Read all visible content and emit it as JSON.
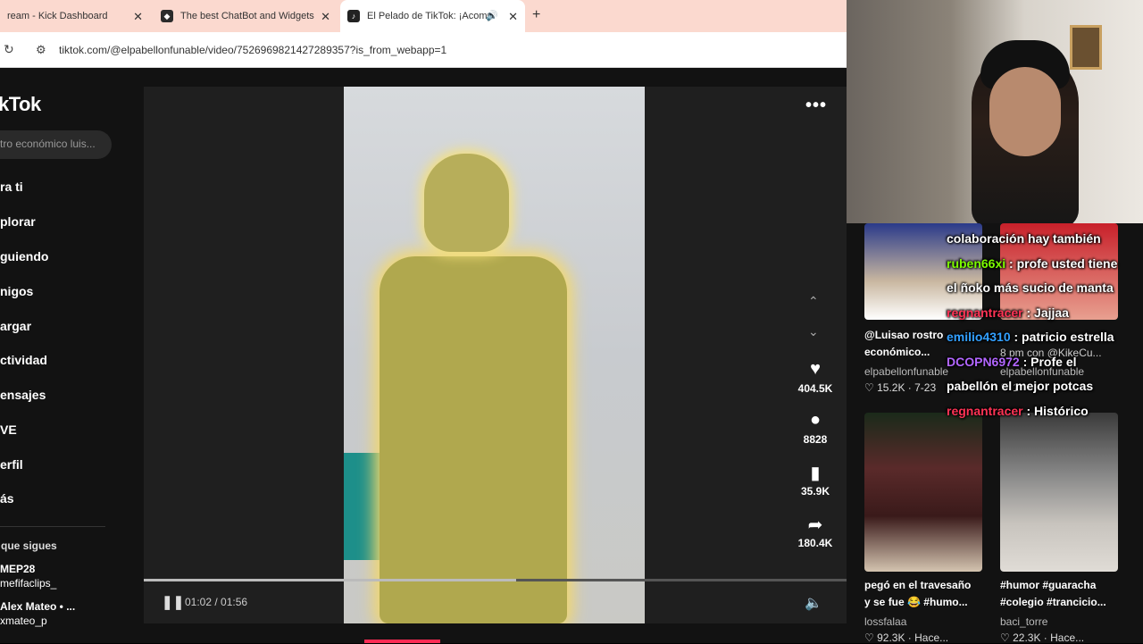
{
  "tabs": [
    {
      "label": "ream - Kick Dashboard",
      "close": "✕"
    },
    {
      "label": "The best ChatBot and Widgets",
      "close": "✕"
    },
    {
      "label": "El Pelado de TikTok: ¡Acomp",
      "close": "✕"
    }
  ],
  "new_tab": "+",
  "address": {
    "url": "tiktok.com/@elpabellonfunable/video/7526969821427289357?is_from_webapp=1"
  },
  "tiktok": {
    "logo": "kTok",
    "search_placeholder": "tro económico luis...",
    "nav": [
      "ra ti",
      "plorar",
      "guiendo",
      "nigos",
      "argar",
      "ctividad",
      "ensajes",
      "VE",
      "erfil",
      "ás"
    ],
    "following_title": "que sigues",
    "following": [
      {
        "name": "MEP28",
        "handle": "mefifaclips_"
      },
      {
        "name": "Alex Mateo • ...",
        "handle": "xmateo_p"
      }
    ],
    "player": {
      "time": "01:02 / 01:56",
      "progress": 0.53,
      "more": "•••"
    },
    "actions": [
      {
        "icon": "heart-icon",
        "glyph": "♥",
        "count": "404.5K"
      },
      {
        "icon": "comment-icon",
        "glyph": "●",
        "count": "8828"
      },
      {
        "icon": "bookmark-icon",
        "glyph": "▮",
        "count": "35.9K"
      },
      {
        "icon": "share-icon",
        "glyph": "➦",
        "count": "180.4K"
      }
    ]
  },
  "side_videos": [
    {
      "caption1": "@Luisao rostro",
      "caption2": "económico...",
      "user": "elpabellonfunable",
      "likes": "♡ 15.2K · 7-23"
    },
    {
      "caption1": "",
      "caption2": "8 pm con @KikeCu...",
      "user": "elpabellonfunable",
      "likes": "♡ 1"
    },
    {
      "caption1": "pegó en el travesaño",
      "caption2": "y se fue 😂 #humo...",
      "user": "lossfalaa",
      "likes": "♡ 92.3K · Hace..."
    },
    {
      "caption1": "#humor #guaracha",
      "caption2": "#colegio #trancicio...",
      "user": "baci_torre",
      "likes": "♡ 22.3K · Hace..."
    }
  ],
  "chat": [
    {
      "user": "",
      "color": "#ffffff",
      "text": "colaboración hay también"
    },
    {
      "user": "ruben66xi",
      "color": "#7cfc00",
      "text": " : profe usted tiene"
    },
    {
      "user": "",
      "color": "#ffffff",
      "text": "el ñoko más sucio de manta"
    },
    {
      "user": "regnantracer",
      "color": "#ff3355",
      "text": " : Jajjaa"
    },
    {
      "user": "emilio4310",
      "color": "#33a0ff",
      "text": " : patricio estrella"
    },
    {
      "user": "DCOPN6972",
      "color": "#b266ff",
      "text": " : Profe el"
    },
    {
      "user": "",
      "color": "#ffffff",
      "text": "pabellón el mejor potcas"
    },
    {
      "user": "regnantracer",
      "color": "#ff3355",
      "text": " : Histórico"
    }
  ]
}
